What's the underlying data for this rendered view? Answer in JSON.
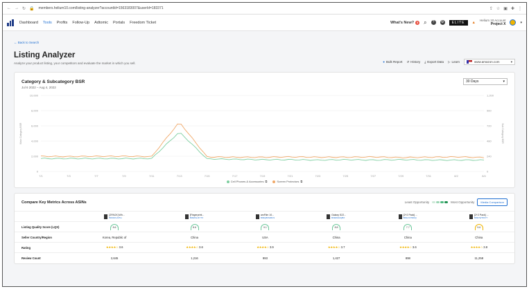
{
  "browser": {
    "url": "members.helium10.com/listing-analyzer?accountId=1563183007&userId=183371"
  },
  "nav": {
    "items": [
      "Dashboard",
      "Tools",
      "Profits",
      "Follow-Up",
      "Adtomic",
      "Portals",
      "Freedom Ticket"
    ],
    "whats_new": "What's New?",
    "whats_new_count": "3",
    "elite": "ELITE",
    "account_line1": "Helium 10 Account",
    "account_line2": "Project X"
  },
  "page": {
    "back": "← Back to Search",
    "title": "Listing Analyzer",
    "subtitle": "Analyze your product listing, your competitors and evaluate the market in which you sell.",
    "actions": [
      "Bulk Report",
      "History",
      "Export Data",
      "Learn"
    ],
    "marketplace": "www.amazon.com"
  },
  "bsr_card": {
    "title": "Category & Subcategory BSR",
    "date_range": "Jul 6 2022 – Aug 4, 2022",
    "period": "30 Days",
    "legend": [
      "Cell Phones & Accessories",
      "Screen Protectors"
    ],
    "left_axis_label": "Main Category BSR",
    "right_axis_label": "Sub Category BSR"
  },
  "chart_data": {
    "type": "line",
    "x": [
      "7/1",
      "7/3",
      "7/7",
      "7/9",
      "7/11",
      "7/13",
      "7/15",
      "7/17",
      "7/19",
      "7/21",
      "7/23",
      "7/25",
      "7/27",
      "7/29",
      "7/31",
      "8/2",
      "8/4"
    ],
    "y_left_ticks": [
      "10,000",
      "8,000",
      "6,000",
      "4,000",
      "2,000",
      "0"
    ],
    "y_right_ticks": [
      "1,200",
      "960",
      "720",
      "480",
      "240",
      "0"
    ],
    "ylim_left": [
      0,
      10000
    ],
    "ylim_right": [
      0,
      1200
    ],
    "series": [
      {
        "name": "Cell Phones & Accessories",
        "color": "#7dcea0",
        "axis": "left",
        "values": [
          1700,
          1700,
          1700,
          1700,
          1700,
          5200,
          1650,
          1600,
          1550,
          1550,
          1500,
          1550,
          1500,
          1550,
          1500,
          1500,
          1500
        ]
      },
      {
        "name": "Screen Protectors",
        "color": "#f0a868",
        "axis": "right",
        "values": [
          240,
          235,
          240,
          240,
          235,
          780,
          230,
          225,
          225,
          230,
          225,
          225,
          230,
          220,
          225,
          230,
          220
        ]
      }
    ]
  },
  "compare": {
    "title": "Compare Key Metrics Across ASINs",
    "least": "Least Opportunity",
    "most": "Most Opportunity",
    "button": "Media Comparison",
    "asins": [
      {
        "name": "[2PACK] Wh...",
        "id": "B09K4VJ2TH"
      },
      {
        "name": "[Fingerprint...",
        "id": "B09WGJ4YTX"
      },
      {
        "name": "amFilm 10...",
        "id": "B09Q8KMMC9"
      },
      {
        "name": "Galaxy S22...",
        "id": "B09M4F2QBX"
      },
      {
        "name": "[2+2 Pack] ...",
        "id": "B09LX4TRDQ"
      },
      {
        "name": "[2+2 Pack] ...",
        "id": "B09CWT8X7Y"
      }
    ],
    "rows": [
      {
        "label": "Listing Quality Score (LQS)",
        "values": [
          "8.6",
          "8.6",
          "9.1",
          "8.8",
          "7.7",
          "5.6"
        ]
      },
      {
        "label": "Seller Country/Region",
        "values": [
          "Korea, Republic of",
          "China",
          "USA",
          "China",
          "China",
          "China"
        ]
      },
      {
        "label": "Rating",
        "values": [
          "3.6",
          "3.6",
          "3.9",
          "3.7",
          "3.6",
          "3.8"
        ]
      },
      {
        "label": "Review Count",
        "values": [
          "2,645",
          "1,216",
          "993",
          "1,427",
          "898",
          "11,258"
        ]
      }
    ]
  }
}
